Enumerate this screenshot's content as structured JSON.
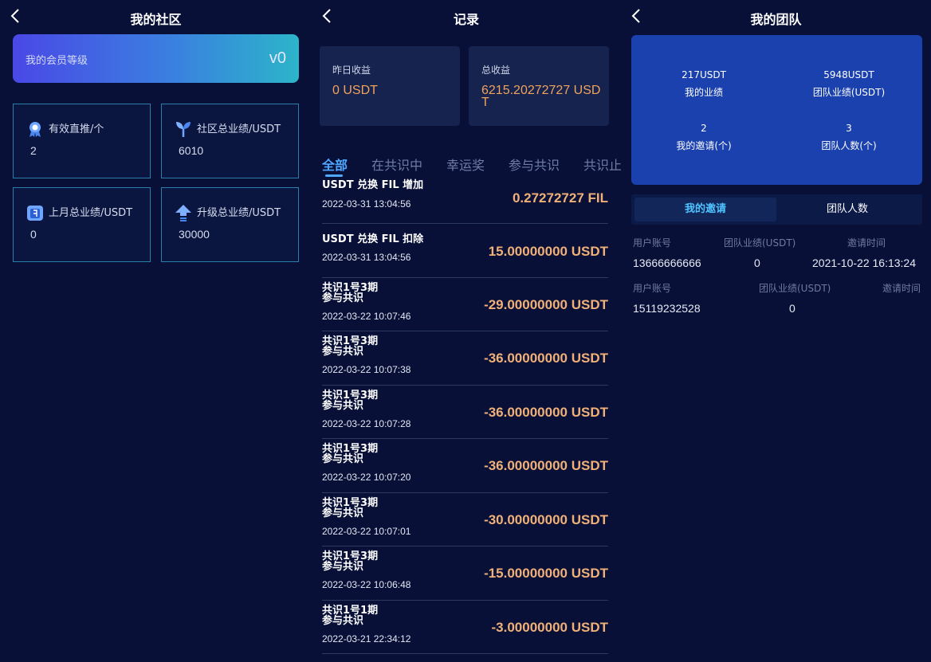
{
  "community": {
    "title": "我的社区",
    "level_label": "我的会员等级",
    "level_value": "v0",
    "stats": [
      {
        "label": "有效直推/个",
        "value": "2",
        "icon": "medal-icon"
      },
      {
        "label": "社区总业绩/USDT",
        "value": "6010",
        "icon": "sprout-icon"
      },
      {
        "label": "上月总业绩/USDT",
        "value": "0",
        "icon": "calendar-icon"
      },
      {
        "label": "升级总业绩/USDT",
        "value": "30000",
        "icon": "upgrade-arrow-icon"
      }
    ]
  },
  "records": {
    "title": "记录",
    "yesterday_label": "昨日收益",
    "yesterday_value": "0 USDT",
    "total_label": "总收益",
    "total_value": "6215.20272727 USDT",
    "tabs": [
      "全部",
      "在共识中",
      "幸运奖",
      "参与共识",
      "共识止"
    ],
    "items": [
      {
        "line1": "USDT 兑换 FIL 增加",
        "line2": "",
        "time": "2022-03-31 13:04:56",
        "amount": "0.27272727 FIL"
      },
      {
        "line1": "USDT 兑换 FIL 扣除",
        "line2": "",
        "time": "2022-03-31 13:04:56",
        "amount": "15.00000000 USDT"
      },
      {
        "line1": "共识1号3期",
        "line2": "参与共识",
        "time": "2022-03-22 10:07:46",
        "amount": "-29.00000000 USDT"
      },
      {
        "line1": "共识1号3期",
        "line2": "参与共识",
        "time": "2022-03-22 10:07:38",
        "amount": "-36.00000000 USDT"
      },
      {
        "line1": "共识1号3期",
        "line2": "参与共识",
        "time": "2022-03-22 10:07:28",
        "amount": "-36.00000000 USDT"
      },
      {
        "line1": "共识1号3期",
        "line2": "参与共识",
        "time": "2022-03-22 10:07:20",
        "amount": "-36.00000000 USDT"
      },
      {
        "line1": "共识1号3期",
        "line2": "参与共识",
        "time": "2022-03-22 10:07:01",
        "amount": "-30.00000000 USDT"
      },
      {
        "line1": "共识1号3期",
        "line2": "参与共识",
        "time": "2022-03-22 10:06:48",
        "amount": "-15.00000000 USDT"
      },
      {
        "line1": "共识1号1期",
        "line2": "参与共识",
        "time": "2022-03-21 22:34:12",
        "amount": "-3.00000000 USDT"
      }
    ]
  },
  "team": {
    "title": "我的团队",
    "my_perf_value": "217USDT",
    "my_perf_label": "我的业绩",
    "team_perf_value": "5948USDT",
    "team_perf_label": "团队业绩(USDT)",
    "invites_value": "2",
    "invites_label": "我的邀请(个)",
    "team_count_value": "3",
    "team_count_label": "团队人数(个)",
    "seg_invites": "我的邀请",
    "seg_team": "团队人数",
    "rows": [
      {
        "h_account": "用户账号",
        "h_perf": "团队业绩(USDT)",
        "h_time": "邀请时间",
        "account": "13666666666",
        "perf": "0",
        "time": "2021-10-22 16:13:24"
      },
      {
        "h_account": "用户账号",
        "h_perf": "团队业绩(USDT)",
        "h_time": "邀请时间",
        "account": "15119232528",
        "perf": "0",
        "time": ""
      }
    ]
  },
  "colors": {
    "background": "#081038",
    "amount": "#f0b078",
    "accent": "#4fa8ff",
    "team_card": "#1a41ae"
  }
}
